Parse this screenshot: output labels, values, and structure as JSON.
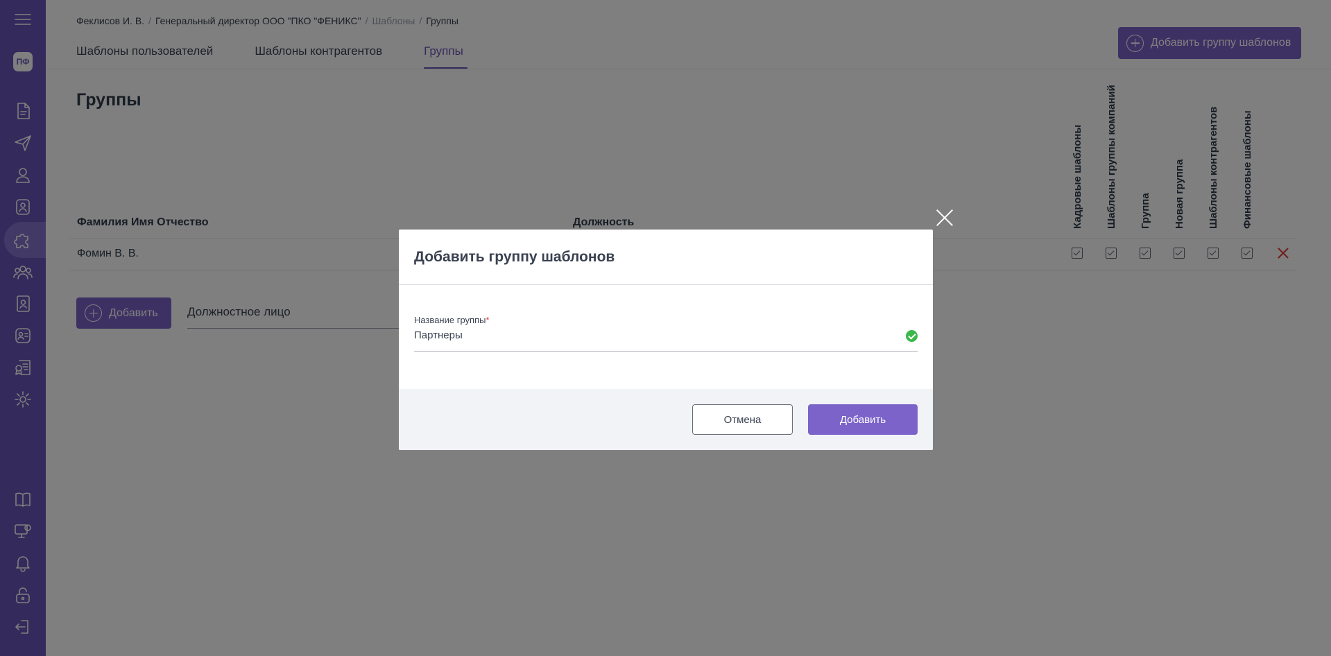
{
  "app": {
    "avatar_initials": "ПФ"
  },
  "sidebar": {
    "items": [
      {
        "icon": "menu-icon"
      },
      {
        "icon": "document-icon"
      },
      {
        "icon": "send-icon"
      },
      {
        "icon": "user-icon"
      },
      {
        "icon": "badge-icon"
      },
      {
        "icon": "puzzle-icon",
        "active": true
      },
      {
        "icon": "users-icon"
      },
      {
        "icon": "contacts-book-icon"
      },
      {
        "icon": "contact-card-icon"
      },
      {
        "icon": "certificate-icon"
      },
      {
        "icon": "gear-icon"
      },
      {
        "icon": "book-icon"
      },
      {
        "icon": "monitor-icon"
      },
      {
        "icon": "bell-icon"
      },
      {
        "icon": "unlock-icon"
      },
      {
        "icon": "logout-icon"
      }
    ]
  },
  "breadcrumb": {
    "user": "Феклисов И. В.",
    "position": "Генеральный директор ООО \"ПКО \"ФЕНИКС\"",
    "section": "Шаблоны",
    "current": "Группы"
  },
  "tabs": [
    {
      "label": "Шаблоны пользователей"
    },
    {
      "label": "Шаблоны контрагентов"
    },
    {
      "label": "Группы",
      "active": true
    }
  ],
  "header": {
    "add_group_button": "Добавить группу шаблонов"
  },
  "page": {
    "title": "Группы"
  },
  "table": {
    "col_name": "Фамилия Имя Отчество",
    "col_position": "Должность",
    "permission_columns": [
      "Кадровые шаблоны",
      "Шаблоны группы компаний",
      "Группа",
      "Новая группа",
      "Шаблоны контрагентов",
      "Финансовые шаблоны"
    ],
    "rows": [
      {
        "name": "Фомин В. В.",
        "checks": [
          true,
          true,
          true,
          true,
          true,
          true
        ]
      }
    ]
  },
  "add_row": {
    "button_label": "Добавить",
    "input_placeholder": "Должностное лицо"
  },
  "modal": {
    "title": "Добавить группу шаблонов",
    "field_label": "Название группы",
    "field_required_mark": "*",
    "field_value": "Партнеры",
    "cancel_label": "Отмена",
    "confirm_label": "Добавить"
  }
}
